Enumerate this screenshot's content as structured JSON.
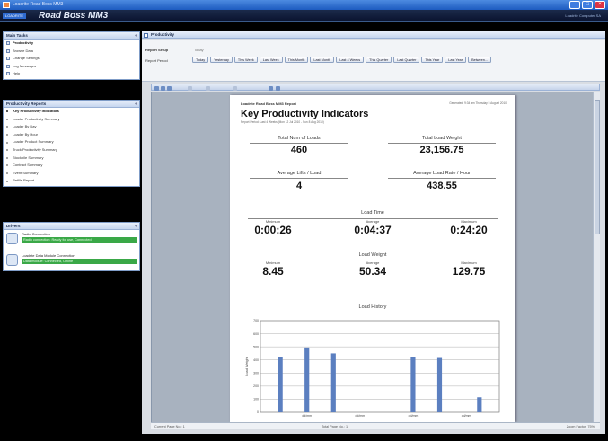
{
  "window": {
    "title": "Loadrite Road Boss MM3"
  },
  "brand": {
    "tag": "LOADRITE",
    "name": "Road Boss MM3",
    "right_text": "Loadrite Computer SA"
  },
  "main_tasks": {
    "title": "Main Tasks",
    "items": [
      "Productivity",
      "Browse Data",
      "Change Settings",
      "Log Messages",
      "Help"
    ]
  },
  "reports": {
    "title": "Productivity Reports",
    "items": [
      "Key Productivity Indicators",
      "Loader Productivity Summary",
      "Loader By Day",
      "Loader By Hour",
      "Loader Product Summary",
      "Truck Productivity Summary",
      "Stockpile Summary",
      "Contract Summary",
      "Event Summary",
      "Refills Report"
    ]
  },
  "drivers": {
    "title": "Drivers",
    "items": [
      {
        "name": "Radio Connection",
        "status": "Radio connection: Ready for use, Connected"
      },
      {
        "name": "Loadrite Data Module Connection",
        "status": "Data module: Connected, Online"
      }
    ]
  },
  "main": {
    "title": "Productivity",
    "report_setup_label": "Report Setup",
    "report_setup_value": "Today",
    "report_period_label": "Report Period",
    "periods": [
      "Today",
      "Yesterday",
      "This Week",
      "Last Week",
      "This Month",
      "Last Month",
      "Last 4 Weeks",
      "This Quarter",
      "Last Quarter",
      "This Year",
      "Last Year",
      "Between..."
    ]
  },
  "status": {
    "left": "Current Page No.: 1",
    "mid": "Total Page No.: 1",
    "right": "Zoom Factor: 75%"
  },
  "report": {
    "app_name": "Loadrite Road Boss MM3 Report",
    "generated": "Generated: 9:34 am Thursday 5 August 2010",
    "title": "Key Productivity Indicators",
    "subtitle": "Report Period: Last 4 Weeks (Mon 12 Jul 2010 - Sun 8 Aug 2010)",
    "total_loads_label": "Total Num of Loads",
    "total_loads": "460",
    "total_weight_label": "Total Load Weight",
    "total_weight": "23,156.75",
    "avg_lifts_label": "Average Lifts / Load",
    "avg_lifts": "4",
    "avg_rate_label": "Average Load Rate / Hour",
    "avg_rate": "438.55",
    "load_time_label": "Load Time",
    "minimum_label": "Minimum",
    "average_label": "Average",
    "maximum_label": "Maximum",
    "time_min": "0:00:26",
    "time_avg": "0:04:37",
    "time_max": "0:24:20",
    "load_weight_label": "Load Weight",
    "weight_min": "8.45",
    "weight_avg": "50.34",
    "weight_max": "129.75"
  },
  "chart_data": {
    "type": "bar",
    "title": "Load History",
    "ylabel": "Load Weight",
    "xlabel": "",
    "ylim": [
      0,
      700
    ],
    "y_ticks": [
      0,
      100,
      200,
      300,
      400,
      500,
      600,
      700
    ],
    "x_tick_labels": [
      "dd/mm",
      "dd/mm",
      "dd/mm",
      "dd/mm"
    ],
    "values": [
      0,
      420,
      0,
      495,
      0,
      450,
      0,
      0,
      0,
      0,
      0,
      420,
      0,
      415,
      0,
      0,
      115,
      0
    ],
    "bar_color": "#5b7fc0"
  }
}
